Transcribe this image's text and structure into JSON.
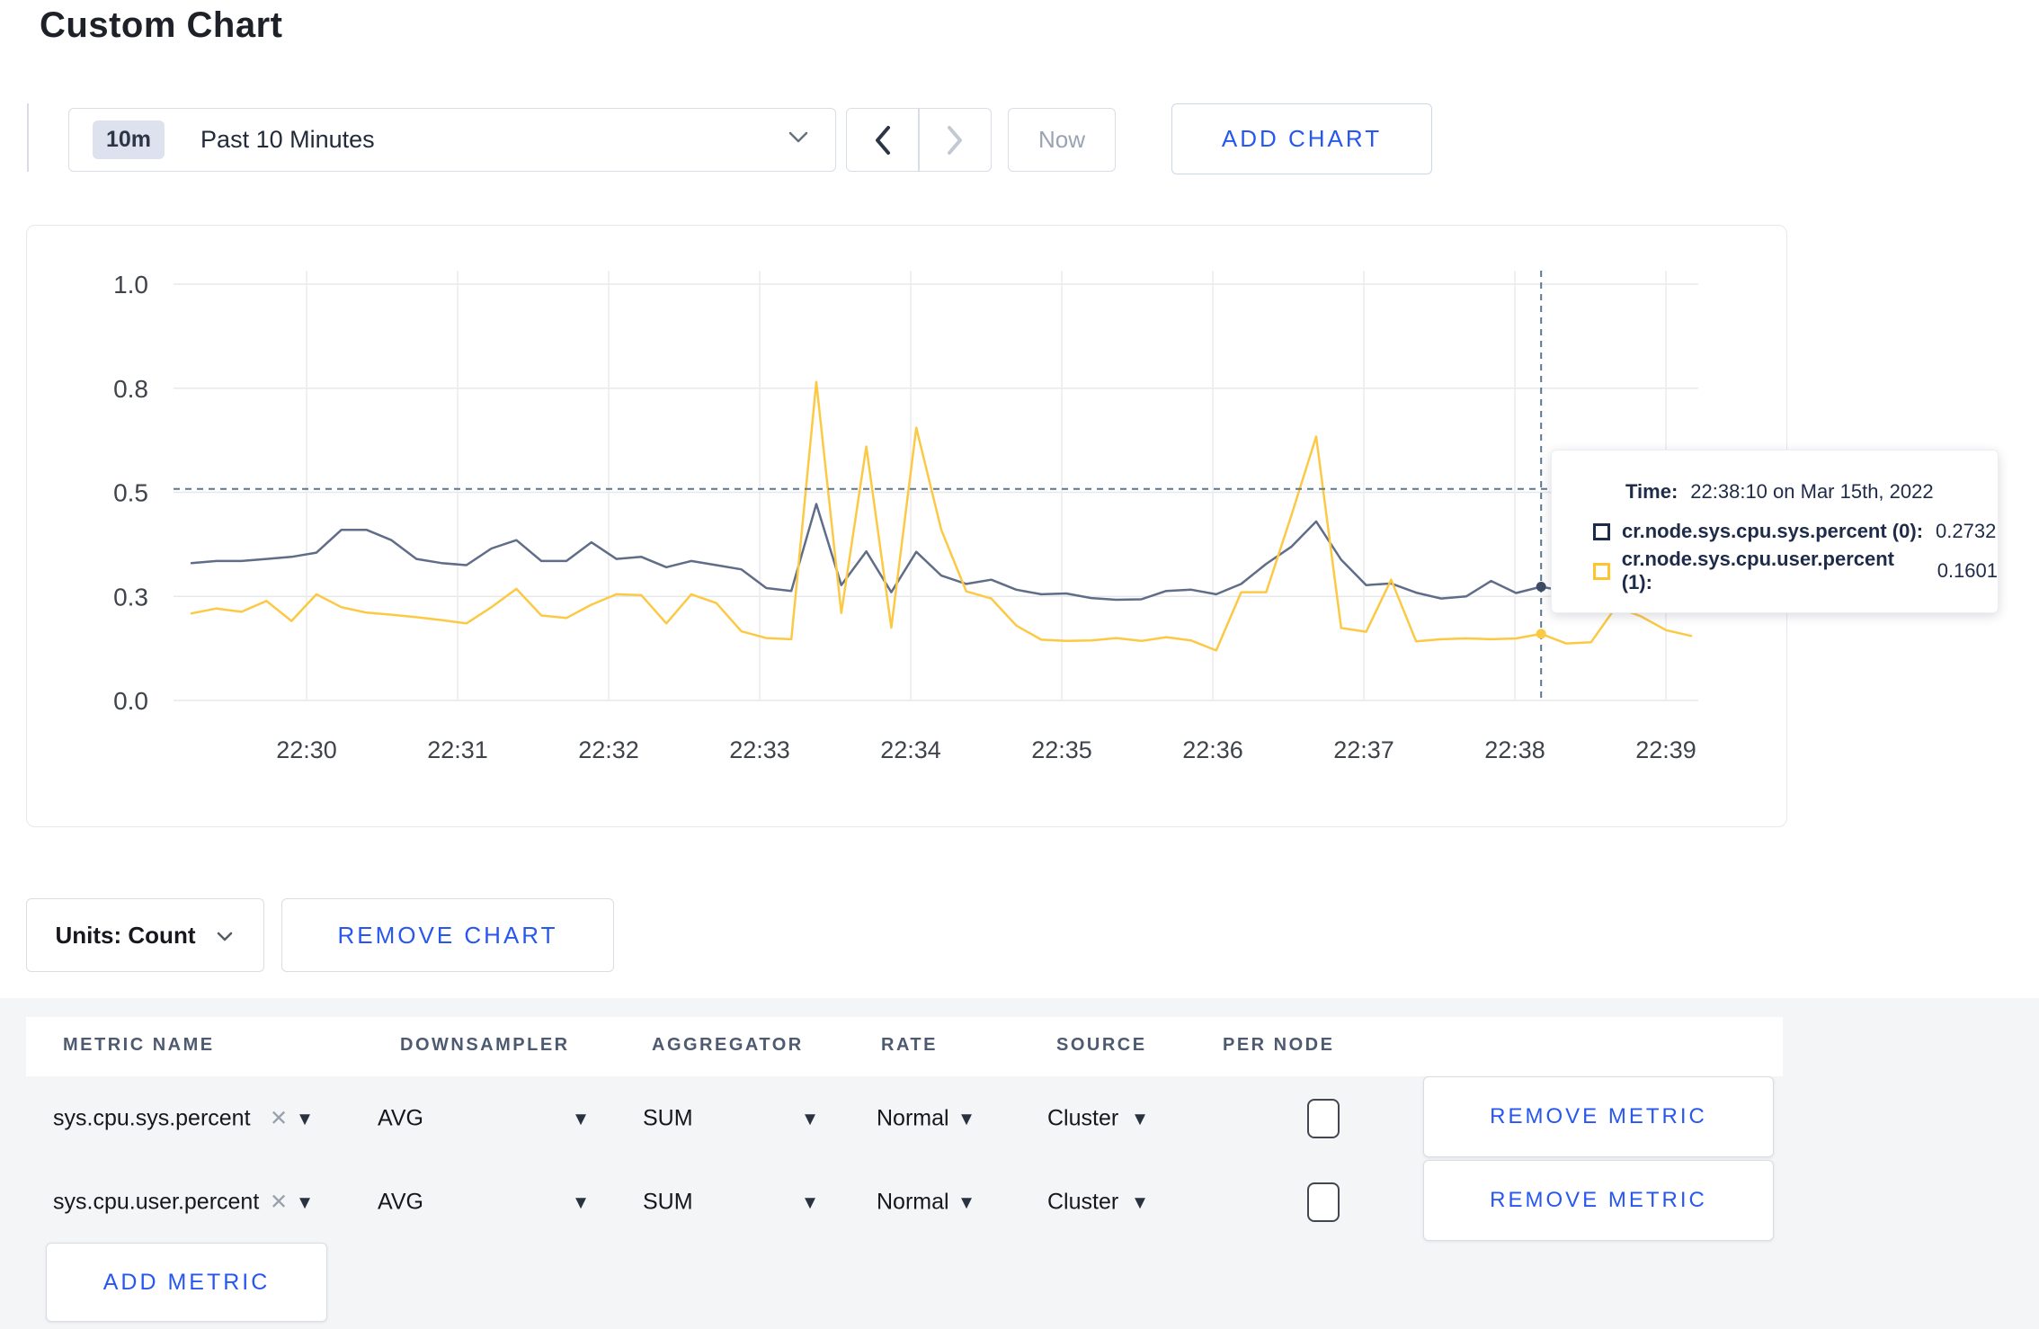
{
  "page": {
    "title": "Custom Chart"
  },
  "toolbar": {
    "time_badge": "10m",
    "time_label": "Past 10 Minutes",
    "now_label": "Now",
    "add_chart_label": "ADD CHART"
  },
  "chart_data": {
    "type": "line",
    "x_start": "22:29:10",
    "x_interval_seconds": 10,
    "x_ticks": [
      "22:30",
      "22:31",
      "22:32",
      "22:33",
      "22:34",
      "22:35",
      "22:36",
      "22:37",
      "22:38",
      "22:39"
    ],
    "y_ticks": [
      {
        "label": "1.0",
        "value": 1.0
      },
      {
        "label": "0.8",
        "value": 0.75
      },
      {
        "label": "0.5",
        "value": 0.5
      },
      {
        "label": "0.3",
        "value": 0.25
      },
      {
        "label": "0.0",
        "value": 0.0
      }
    ],
    "ylim": [
      0,
      1
    ],
    "grid": true,
    "series": [
      {
        "name": "cr.node.sys.cpu.sys.percent",
        "color": "#5f6d88",
        "values": [
          0.33,
          0.335,
          0.335,
          0.34,
          0.345,
          0.355,
          0.41,
          0.41,
          0.385,
          0.34,
          0.33,
          0.325,
          0.365,
          0.385,
          0.335,
          0.335,
          0.38,
          0.34,
          0.345,
          0.32,
          0.335,
          0.325,
          0.315,
          0.27,
          0.263,
          0.472,
          0.277,
          0.358,
          0.26,
          0.357,
          0.3,
          0.28,
          0.29,
          0.266,
          0.255,
          0.257,
          0.246,
          0.242,
          0.243,
          0.263,
          0.266,
          0.255,
          0.28,
          0.328,
          0.369,
          0.43,
          0.338,
          0.277,
          0.281,
          0.259,
          0.245,
          0.25,
          0.287,
          0.258,
          0.2732,
          0.262,
          0.27,
          0.29,
          0.3,
          0.295,
          0.3
        ]
      },
      {
        "name": "cr.node.sys.cpu.user.percent",
        "color": "#fcc944",
        "values": [
          0.209,
          0.221,
          0.213,
          0.239,
          0.191,
          0.255,
          0.224,
          0.211,
          0.206,
          0.2,
          0.193,
          0.185,
          0.224,
          0.268,
          0.204,
          0.198,
          0.23,
          0.255,
          0.253,
          0.185,
          0.255,
          0.234,
          0.166,
          0.15,
          0.147,
          0.765,
          0.21,
          0.61,
          0.175,
          0.655,
          0.41,
          0.262,
          0.245,
          0.18,
          0.146,
          0.143,
          0.144,
          0.15,
          0.143,
          0.152,
          0.144,
          0.12,
          0.26,
          0.26,
          0.443,
          0.634,
          0.174,
          0.165,
          0.29,
          0.142,
          0.147,
          0.149,
          0.147,
          0.149,
          0.1601,
          0.137,
          0.14,
          0.225,
          0.202,
          0.169,
          0.155
        ]
      }
    ],
    "crosshair": {
      "x_index": 54,
      "time": "22:38:10",
      "guideline_y_value": 0.508
    }
  },
  "tooltip": {
    "time_label": "Time:",
    "time_value": "22:38:10 on Mar 15th, 2022",
    "rows": [
      {
        "label": "cr.node.sys.cpu.sys.percent (0):",
        "value": "0.2732",
        "color": "#1c2b4a"
      },
      {
        "label": "cr.node.sys.cpu.user.percent (1):",
        "value": "0.1601",
        "color": "#fdc42f"
      }
    ]
  },
  "chart_controls": {
    "units_label": "Units: Count",
    "remove_chart_label": "REMOVE CHART"
  },
  "metrics_table": {
    "headers": [
      "METRIC NAME",
      "DOWNSAMPLER",
      "AGGREGATOR",
      "RATE",
      "SOURCE",
      "PER NODE"
    ],
    "rows": [
      {
        "metric": "sys.cpu.sys.percent",
        "downsampler": "AVG",
        "aggregator": "SUM",
        "rate": "Normal",
        "source": "Cluster",
        "per_node": false,
        "remove_label": "REMOVE METRIC"
      },
      {
        "metric": "sys.cpu.user.percent",
        "downsampler": "AVG",
        "aggregator": "SUM",
        "rate": "Normal",
        "source": "Cluster",
        "per_node": false,
        "remove_label": "REMOVE METRIC"
      }
    ],
    "add_metric_label": "ADD METRIC"
  }
}
